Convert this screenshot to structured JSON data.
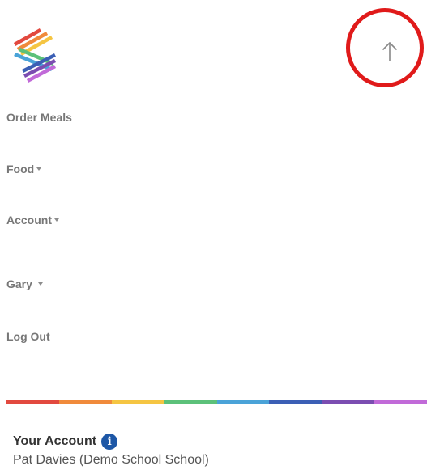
{
  "header": {
    "logo_icon": "rainbow-chevron-logo",
    "scroll_top_icon": "arrow-up-icon",
    "highlight_color": "#e01a1a"
  },
  "nav": {
    "order_meals": "Order Meals",
    "food": "Food",
    "account": "Account",
    "user": "Gary",
    "log_out": "Log Out"
  },
  "divider": {
    "colors": [
      "#e2493f",
      "#f08a3b",
      "#f5c542",
      "#5cc17a",
      "#4aa3d8",
      "#3b5fb5",
      "#7b4db1",
      "#c16ad8"
    ]
  },
  "account": {
    "title": "Your Account",
    "info_icon": "info-icon",
    "info_glyph": "i",
    "name": "Pat Davies (Demo School School)"
  }
}
